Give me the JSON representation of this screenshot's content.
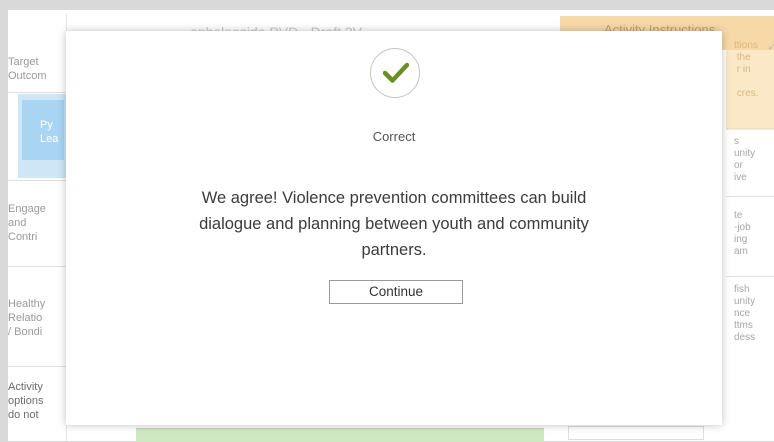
{
  "background": {
    "title_fragment": "onbeleeside PVD - Draft 2V",
    "right_header": "Activity Instructions",
    "left_rows": [
      [
        "Target",
        "Outcom"
      ],
      [
        "Py",
        "Lea"
      ],
      [
        "Engage",
        "and",
        "Contri"
      ],
      [
        "Healthy",
        "Relatio",
        "/ Bondi"
      ],
      [
        "Activity",
        "options",
        "do not"
      ]
    ],
    "right_fragments": [
      "ttions\n the\n r in\n\n cres.",
      "s\nunity\nor\nive",
      "te\n-job\ning\nam",
      "fish\nunity\nnce\nttms\ndess"
    ]
  },
  "modal": {
    "icon": "checkmark-icon",
    "status_text": "Correct",
    "message": "We agree! Violence prevention committees can build dialogue and planning between youth and community partners.",
    "continue_label": "Continue",
    "accent_color": "#6b8e23"
  }
}
